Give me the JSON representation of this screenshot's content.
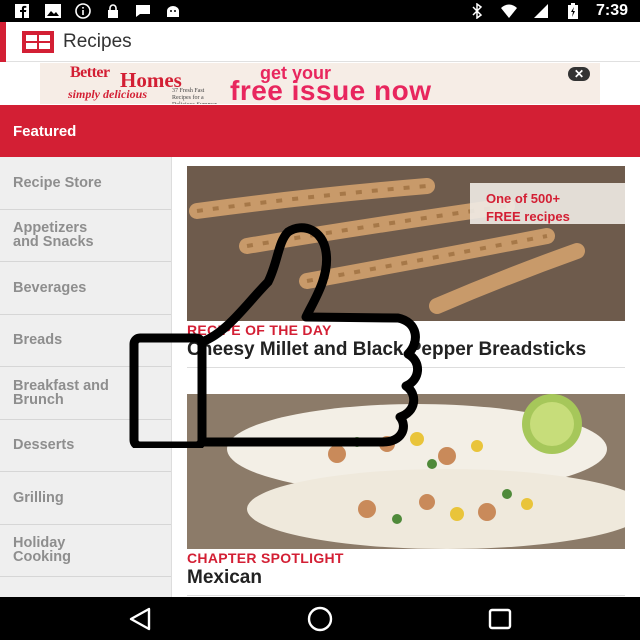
{
  "status_bar": {
    "time": "7:39",
    "icons_left": [
      "facebook-icon",
      "photos-icon",
      "info-icon",
      "lock-icon",
      "sms-icon",
      "android-icon"
    ],
    "icons_right": [
      "bluetooth-icon",
      "wifi-icon",
      "signal-icon",
      "battery-icon"
    ]
  },
  "app_bar": {
    "title": "Recipes"
  },
  "ad": {
    "brand_line1": "Better",
    "brand_line2": "Homes",
    "brand_line3": "simply delicious",
    "brand_line4": "37 Fresh Fast Recipes for a Delicious Summer",
    "headline_small": "get your",
    "headline_big": "free issue now",
    "close_symbol": "✕"
  },
  "featured": {
    "label": "Featured"
  },
  "sidebar": {
    "items": [
      {
        "label": "Recipe Store"
      },
      {
        "label": "Appetizers\nand Snacks"
      },
      {
        "label": "Beverages"
      },
      {
        "label": "Breads"
      },
      {
        "label": "Breakfast and\nBrunch"
      },
      {
        "label": "Desserts"
      },
      {
        "label": "Grilling"
      },
      {
        "label": "Holiday\nCooking"
      }
    ]
  },
  "cards": [
    {
      "badge": "One of 500+\nFREE recipes",
      "kicker": "RECIPE OF THE DAY",
      "title": "Cheesy Millet and Black Pepper Breadsticks"
    },
    {
      "kicker": "CHAPTER SPOTLIGHT",
      "title": "Mexican"
    }
  ],
  "colors": {
    "brand_red": "#d31f34",
    "ad_pink": "#e8265e"
  }
}
